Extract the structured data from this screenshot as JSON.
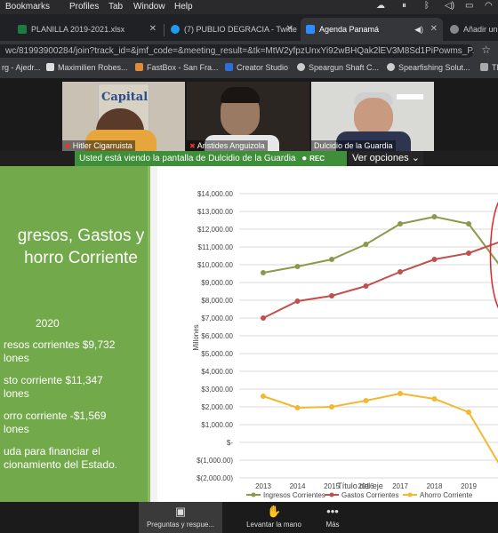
{
  "menubar": {
    "items": [
      "Help"
    ],
    "items_full": [
      "Bookmarks",
      "Profiles",
      "Tab",
      "Window",
      "Help"
    ]
  },
  "tabs": [
    {
      "title": "PLANILLA 2019-2021.xlsx",
      "favicon_color": "#1e7a43"
    },
    {
      "title": "(7) PUBLIO DEGRACIA - Twitte",
      "favicon_color": "#1d9bf0"
    },
    {
      "title": "Agenda Panamá",
      "favicon_color": "#2d8cff"
    },
    {
      "title": "Añadir un",
      "favicon_color": "#888888"
    }
  ],
  "url": "wc/81993900284/join?track_id=&jmf_code=&meeting_result=&tk=MtW2yfpzUnxYi92wBHQak2lEV3M8Sd1PiPowms_P...",
  "bookmarks": [
    "rg - Ajedr...",
    "Maximilien Robes...",
    "FastBox - San Fra...",
    "Creator Studio",
    "Speargun Shaft C...",
    "Spearfishing Solut...",
    "TE"
  ],
  "participants": [
    {
      "name": "Hitler Cigarruista"
    },
    {
      "name": "Aristides Anguizola"
    },
    {
      "name": "Dulcidio de la Guardia"
    }
  ],
  "video_backdrop_text": "Capital",
  "share_banner": {
    "text": "Usted está viendo la pantalla de Dulcidio de la Guardia",
    "rec": "REC",
    "view_options": "Ver opciones"
  },
  "slide": {
    "title": "gresos, Gastos y\nhorro Corriente",
    "year": "2020",
    "bullets": [
      "resos corrientes $9,732\nlones",
      "sto corriente $11,347\nlones",
      "orro corriente -$1,569\nlones",
      "uda para financiar el\ncionamiento del Estado."
    ]
  },
  "chart_data": {
    "type": "line",
    "ylabel": "Millones",
    "xlabel": "Título del eje",
    "categories": [
      "2013",
      "2014",
      "2015",
      "2016",
      "2017",
      "2018",
      "2019",
      "20"
    ],
    "y_tick_labels": [
      "$14,000.00",
      "$13,000.00",
      "$12,000.00",
      "$11,000.00",
      "$10,000.00",
      "$9,000.00",
      "$8,000.00",
      "$7,000.00",
      "$6,000.00",
      "$5,000.00",
      "$4,000.00",
      "$3,000.00",
      "$2,000.00",
      "$1,000.00",
      "$-",
      "$(1,000.00)",
      "$(2,000.00)"
    ],
    "ylim": [
      -2000,
      14000
    ],
    "grid": true,
    "legend_position": "bottom",
    "series": [
      {
        "name": "Ingresos Corrientes",
        "color": "#8a9a4a",
        "values": [
          9550,
          9900,
          10300,
          11150,
          12300,
          12700,
          12300,
          9732
        ]
      },
      {
        "name": "Gastos Corrientes",
        "color": "#c0504d",
        "values": [
          7000,
          7950,
          8250,
          8800,
          9600,
          10300,
          10650,
          11347
        ]
      },
      {
        "name": "Ahorro Corriente",
        "color": "#f2b830",
        "values": [
          2600,
          1950,
          2000,
          2350,
          2750,
          2450,
          1700,
          -1569
        ]
      }
    ],
    "annotation": {
      "shape": "ellipse",
      "color": "#e0262b"
    }
  },
  "toolbar": {
    "qa_label": "Preguntas y respue...",
    "raise_label": "Levantar la mano",
    "more_label": "Más"
  }
}
